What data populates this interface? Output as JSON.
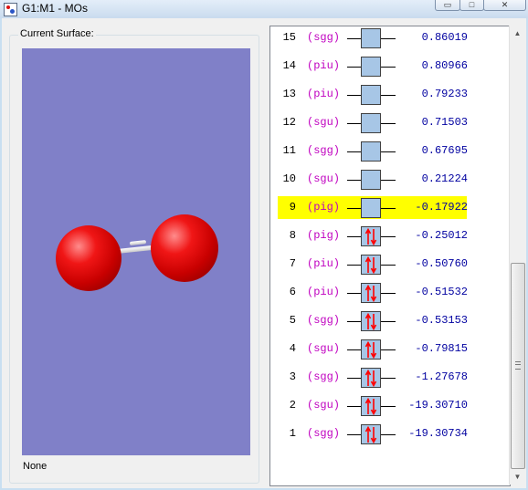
{
  "window": {
    "title": "G1:M1 - MOs",
    "minimize_glyph": "▭",
    "maximize_glyph": "□",
    "close_glyph": "✕"
  },
  "surface": {
    "group_label": "Current Surface:",
    "status_text": "None",
    "viewport_color": "#8080c8",
    "atom_color": "#e00000",
    "bond_color": "#ffffff"
  },
  "orbitals": [
    {
      "number": "15",
      "symmetry": "(sgg)",
      "energy": "0.86019",
      "occupied": false,
      "highlighted": false
    },
    {
      "number": "14",
      "symmetry": "(piu)",
      "energy": "0.80966",
      "occupied": false,
      "highlighted": false
    },
    {
      "number": "13",
      "symmetry": "(piu)",
      "energy": "0.79233",
      "occupied": false,
      "highlighted": false
    },
    {
      "number": "12",
      "symmetry": "(sgu)",
      "energy": "0.71503",
      "occupied": false,
      "highlighted": false
    },
    {
      "number": "11",
      "symmetry": "(sgg)",
      "energy": "0.67695",
      "occupied": false,
      "highlighted": false
    },
    {
      "number": "10",
      "symmetry": "(sgu)",
      "energy": "0.21224",
      "occupied": false,
      "highlighted": false
    },
    {
      "number": "9",
      "symmetry": "(pig)",
      "energy": "-0.17922",
      "occupied": false,
      "highlighted": true
    },
    {
      "number": "8",
      "symmetry": "(pig)",
      "energy": "-0.25012",
      "occupied": true,
      "highlighted": false
    },
    {
      "number": "7",
      "symmetry": "(piu)",
      "energy": "-0.50760",
      "occupied": true,
      "highlighted": false
    },
    {
      "number": "6",
      "symmetry": "(piu)",
      "energy": "-0.51532",
      "occupied": true,
      "highlighted": false
    },
    {
      "number": "5",
      "symmetry": "(sgg)",
      "energy": "-0.53153",
      "occupied": true,
      "highlighted": false
    },
    {
      "number": "4",
      "symmetry": "(sgu)",
      "energy": "-0.79815",
      "occupied": true,
      "highlighted": false
    },
    {
      "number": "3",
      "symmetry": "(sgg)",
      "energy": "-1.27678",
      "occupied": true,
      "highlighted": false
    },
    {
      "number": "2",
      "symmetry": "(sgu)",
      "energy": "-19.30710",
      "occupied": true,
      "highlighted": false
    },
    {
      "number": "1",
      "symmetry": "(sgg)",
      "energy": "-19.30734",
      "occupied": true,
      "highlighted": false
    }
  ],
  "colors": {
    "highlight": "#ffff00",
    "symmetry_text": "#c000c0",
    "energy_text": "#0000a0",
    "orbital_box": "#a7c6e6",
    "spin_arrow": "#ff0000"
  },
  "scrollbar": {
    "up_glyph": "▲",
    "down_glyph": "▼"
  }
}
